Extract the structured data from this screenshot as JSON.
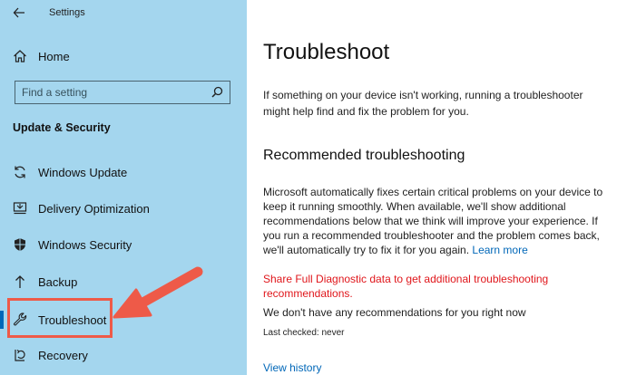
{
  "window": {
    "title": "Settings"
  },
  "sidebar": {
    "home_label": "Home",
    "search_placeholder": "Find a setting",
    "section_title": "Update & Security",
    "items": [
      {
        "label": "Windows Update",
        "icon": "sync-icon"
      },
      {
        "label": "Delivery Optimization",
        "icon": "delivery-icon"
      },
      {
        "label": "Windows Security",
        "icon": "shield-icon"
      },
      {
        "label": "Backup",
        "icon": "upload-arrow-icon"
      },
      {
        "label": "Troubleshoot",
        "icon": "wrench-icon",
        "selected": true
      },
      {
        "label": "Recovery",
        "icon": "recovery-icon"
      }
    ]
  },
  "main": {
    "title": "Troubleshoot",
    "intro": "If something on your device isn't working, running a troubleshooter might help find and fix the problem for you.",
    "subhead": "Recommended troubleshooting",
    "body": "Microsoft automatically fixes certain critical problems on your device to keep it running smoothly. When available, we'll show additional recommendations below that we think will improve your experience. If you run a recommended troubleshooter and the problem comes back, we'll automatically try to fix it for you again.",
    "learn_more": "Learn more",
    "diagnostic_link": "Share Full Diagnostic data to get additional troubleshooting recommendations.",
    "no_recommendations": "We don't have any recommendations for you right now",
    "last_checked": "Last checked: never",
    "view_history": "View history"
  },
  "colors": {
    "sidebar_bg": "#a4d6ee",
    "accent": "#0067b8",
    "warning_red": "#e0161b",
    "annotation": "#ee5a48"
  }
}
